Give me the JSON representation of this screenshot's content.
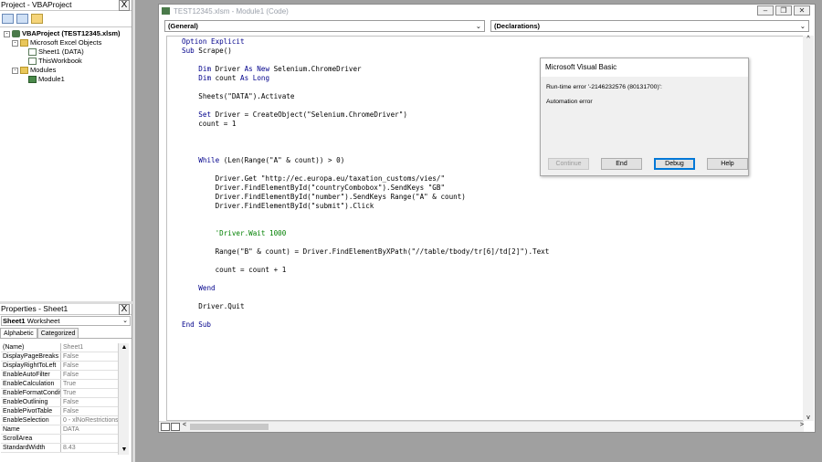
{
  "project_pane": {
    "title": "Project - VBAProject",
    "close": "X",
    "tree": [
      {
        "label": "VBAProject (TEST12345.xlsm)",
        "depth": 0,
        "icon": "vba-project-icon",
        "toggle": "-"
      },
      {
        "label": "Microsoft Excel Objects",
        "depth": 1,
        "icon": "folder-icon",
        "toggle": "-"
      },
      {
        "label": "Sheet1 (DATA)",
        "depth": 2,
        "icon": "sheet-icon",
        "toggle": ""
      },
      {
        "label": "ThisWorkbook",
        "depth": 2,
        "icon": "workbook-icon",
        "toggle": ""
      },
      {
        "label": "Modules",
        "depth": 1,
        "icon": "folder-icon",
        "toggle": "-"
      },
      {
        "label": "Module1",
        "depth": 2,
        "icon": "module-icon",
        "toggle": ""
      }
    ]
  },
  "properties_pane": {
    "title": "Properties - Sheet1",
    "close": "X",
    "object_name": "Sheet1",
    "object_type": "Worksheet",
    "tabs": [
      "Alphabetic",
      "Categorized"
    ],
    "rows": [
      {
        "name": "(Name)",
        "value": "Sheet1"
      },
      {
        "name": "DisplayPageBreaks",
        "value": "False"
      },
      {
        "name": "DisplayRightToLeft",
        "value": "False"
      },
      {
        "name": "EnableAutoFilter",
        "value": "False"
      },
      {
        "name": "EnableCalculation",
        "value": "True"
      },
      {
        "name": "EnableFormatConditic",
        "value": "True"
      },
      {
        "name": "EnableOutlining",
        "value": "False"
      },
      {
        "name": "EnablePivotTable",
        "value": "False"
      },
      {
        "name": "EnableSelection",
        "value": "0 - xlNoRestrictions"
      },
      {
        "name": "Name",
        "value": "DATA"
      },
      {
        "name": "ScrollArea",
        "value": ""
      },
      {
        "name": "StandardWidth",
        "value": "8.43"
      }
    ]
  },
  "code_window": {
    "title": "TEST12345.xlsm - Module1 (Code)",
    "object_combo": "(General)",
    "proc_combo": "(Declarations)",
    "lines": [
      "Option Explicit",
      "Sub Scrape()",
      "",
      "    Dim Driver As New Selenium.ChromeDriver",
      "    Dim count As Long",
      "",
      "    Sheets(\"DATA\").Activate",
      "",
      "    Set Driver = CreateObject(\"Selenium.ChromeDriver\")",
      "    count = 1",
      "",
      "",
      "",
      "    While (Len(Range(\"A\" & count)) > 0)",
      "",
      "        Driver.Get \"http://ec.europa.eu/taxation_customs/vies/\"",
      "        Driver.FindElementById(\"countryCombobox\").SendKeys \"GB\"",
      "        Driver.FindElementById(\"number\").SendKeys Range(\"A\" & count)",
      "        Driver.FindElementById(\"submit\").Click",
      "",
      "",
      "        'Driver.Wait 1000",
      "",
      "        Range(\"B\" & count) = Driver.FindElementByXPath(\"//table/tbody/tr[6]/td[2]\").Text",
      "",
      "        count = count + 1",
      "",
      "    Wend",
      "",
      "    Driver.Quit",
      "",
      "End Sub"
    ]
  },
  "dialog": {
    "title": "Microsoft Visual Basic",
    "message": "Run-time error '-2146232576 (80131700)':",
    "detail": "Automation error",
    "buttons": [
      "Continue",
      "End",
      "Debug",
      "Help"
    ]
  }
}
